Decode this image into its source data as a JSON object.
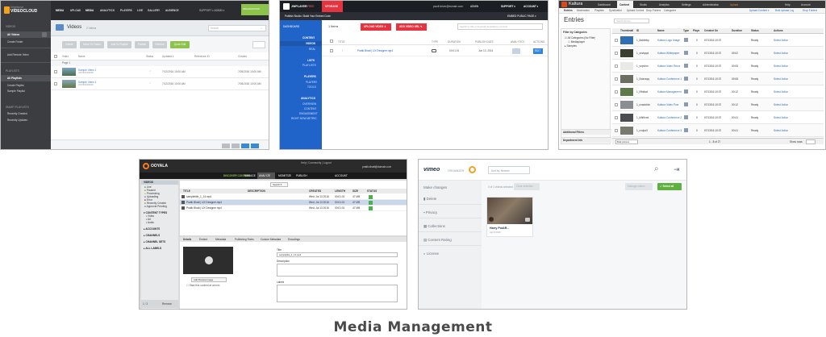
{
  "caption": "Media Management",
  "brightcove": {
    "brand_top": "brightcove",
    "brand": "VIDEOCLOUD",
    "nav": [
      "MEDIA",
      "UPLOAD",
      "MEDIA",
      "ANALYTICS",
      "PLAYERS",
      "LIVE",
      "GALLERY",
      "AUDIENCE"
    ],
    "user": "SUPPORT ▾  ADMIN ▾",
    "badge": "ORGANIZATION",
    "side_header": "VIDEOS",
    "side_items": [
      "All Videos",
      "Create Folder"
    ],
    "side_add": "Add Remote Video",
    "side_playlists_header": "PLAYLISTS",
    "side_playlists": [
      "All Playlists",
      "Create Playlist",
      "Sample Playlist"
    ],
    "side_smart_header": "SMART PLAYLISTS",
    "side_smart": [
      "Recently Created",
      "Recently Updated"
    ],
    "page_title": "Videos",
    "page_count": "2 Videos",
    "search_placeholder": "Search",
    "toolbar_buttons": [
      "Delete",
      "Move To Folder",
      "Add To Playlist",
      "Publish",
      "Refresh",
      "Quick Edit"
    ],
    "columns": [
      "Video",
      "Name",
      "Status",
      "Updated ▾",
      "Reference ID",
      "Created"
    ],
    "page_label": "Page 1",
    "rows": [
      {
        "name": "Sample Video 2",
        "sub": "2207902408400",
        "date": "7/12/2016 10:00 AM",
        "created": "7/05/2016 10:00 AM"
      },
      {
        "name": "Sample Video 1",
        "sub": "2207902408400",
        "date": "7/12/2016 10:00 AM",
        "created": "7/05/2016 10:00 AM"
      }
    ]
  },
  "jwplayer": {
    "brand": "JWPLAYER",
    "plan": "FREE",
    "upgrade": "UPGRADE",
    "crumb": "Publish Studio  /  Build Your Embed Code",
    "email": "pwolf.driver@domain.com",
    "top_right": [
      "ADMIN",
      "SUPPORT ▾",
      "ACCOUNT ▾"
    ],
    "sub_link": "EMBED PUBLIC PAGE ▾",
    "side_top": "DASHBOARD",
    "side_groups": [
      {
        "header": "CONTENT",
        "items": [
          "VIDEOS",
          "REAL"
        ]
      },
      {
        "header": "LISTS",
        "items": [
          "PLAYLISTS"
        ]
      },
      {
        "header": "PLAYERS",
        "items": [
          "PLAYERS",
          "TOOLS"
        ]
      },
      {
        "header": "ANALYTICS",
        "items": [
          "OVERVIEW",
          "CONTENT",
          "ENGAGEMENT",
          "RIGHT NOW METRIC"
        ]
      }
    ],
    "count": "1 Items",
    "search_placeholder": "Search by title or keyword (separate by comma)",
    "upload_button": "UPLOAD VIDEO ⬆",
    "add_button": "ADD VIDEO URL ✎",
    "columns": [
      "TITLE",
      "TYPE",
      "DURATION",
      "PUBLISH DATE",
      "ANALYTICS",
      "ACTIONS"
    ],
    "row": {
      "title": "Pratik Bhatt | UX Designer.mp4",
      "duration": "00:01:01",
      "date": "Jun 13, 2016",
      "action": "EDIT"
    }
  },
  "kaltura": {
    "brand": "Kaltura",
    "top_tabs": [
      "Dashboard",
      "Content",
      "Studio",
      "Analytics",
      "Settings",
      "Administration"
    ],
    "help_links": [
      "Upload",
      "Help",
      "Account"
    ],
    "sub_tabs": [
      "Entries",
      "Moderation",
      "Playlists",
      "Syndication",
      "Upload Control",
      "Drop Folders",
      "Categories"
    ],
    "sub_right": [
      "Upload Content ▾",
      "Bulk Upload Log",
      "Drop Folders"
    ],
    "title": "Entries",
    "search_placeholder": "Search Entries",
    "filter_header": "Filter by Categories",
    "filter_items": [
      "All Categories (No Filter)",
      "Mediaplayer",
      "Samples"
    ],
    "columns": [
      "Thumbnail",
      "ID",
      "Name",
      "Type",
      "Plays",
      "Created On",
      "Duration",
      "Status",
      "Actions"
    ],
    "rows": [
      {
        "id": "1_8abbbkp",
        "name": "Kaltura Logo Image",
        "plays": "0",
        "date": "07/13/16 10:37",
        "dur": "",
        "status": "Ready",
        "action": "Select Action",
        "thumb": "#2f6fb3"
      },
      {
        "id": "1_zxvlqopt",
        "name": "Kaltura Whitepaper",
        "plays": "0",
        "date": "07/13/16 10:37",
        "dur": "00:02",
        "status": "Ready",
        "action": "Select Action",
        "thumb": "#3a3f2f"
      },
      {
        "id": "1_vnpvkm",
        "name": "Kaltura Video Recor",
        "plays": "0",
        "date": "07/13/16 10:37",
        "dur": "00:05",
        "status": "Ready",
        "action": "Select Action",
        "thumb": "#e9e9e6"
      },
      {
        "id": "1_0slzvxqq",
        "name": "Kaltura Conference 1",
        "plays": "0",
        "date": "07/13/16 10:37",
        "dur": "00:08",
        "status": "Ready",
        "action": "Select Action",
        "thumb": "#6b6f62"
      },
      {
        "id": "1_l9fnlkwl",
        "name": "Kaltura Management",
        "plays": "0",
        "date": "07/13/16 10:37",
        "dur": "00:12",
        "status": "Ready",
        "action": "Select Action",
        "thumb": "#5f7a4a"
      },
      {
        "id": "1_uvadohkn",
        "name": "Kaltura Video Pow",
        "plays": "0",
        "date": "07/13/16 10:37",
        "dur": "00:12",
        "status": "Ready",
        "action": "Select Action",
        "thumb": "#8a8d91"
      },
      {
        "id": "1_kifk9xml",
        "name": "Kaltura Conference 2",
        "plays": "0",
        "date": "07/13/16 10:37",
        "dur": "00:41",
        "status": "Ready",
        "action": "Select Action",
        "thumb": "#4a4d52"
      },
      {
        "id": "1_uvdpx3",
        "name": "Kaltura Conference 3",
        "plays": "0",
        "date": "07/13/16 10:37",
        "dur": "00:41",
        "status": "Ready",
        "action": "Select Action",
        "thumb": "#777a6c"
      }
    ],
    "additional_filters": "Additional Filters",
    "department": "Department Info",
    "bulk": "Bulk Actions",
    "pagination": "1 - 8 of 27",
    "show_rows": "Show rows"
  },
  "ooyala": {
    "brand": "OOYALA",
    "top_tabs": [
      "MANAGE",
      "ANALYZE",
      "MONETIZE",
      "PUBLISH"
    ],
    "discover": "DISCOVER CONTENT",
    "account_tab": "ACCOUNT",
    "help": "Help | Community | Logout",
    "user": "pratik.bhatt@domain.com",
    "filters": [
      "Live",
      "Paused",
      "Processing",
      "Uploading",
      "Error",
      "Recently Created",
      "Approval Pending"
    ],
    "videos_header": "VIDEOS",
    "content_types_header": "CONTENT TYPES",
    "content_types": [
      "Video",
      "Ad",
      "Audio"
    ],
    "sections": [
      "ACCOUNTS",
      "CHANNELS",
      "CHANNEL SETS",
      "ALL LABELS"
    ],
    "search_button": "Search ▾",
    "columns": [
      "TITLE",
      "DESCRIPTION",
      "CREATED",
      "LENGTH",
      "SIZE",
      "STATUS"
    ],
    "rows": [
      {
        "title": "sampletitle_1_14.mp4",
        "created": "Wed, Jul 13 2016",
        "length": "00:01:01",
        "size": "47 MB"
      },
      {
        "title": "Pratik Bhatt | UX Designer.mp4",
        "created": "Wed, Jul 13 2016",
        "length": "00:01:01",
        "size": "47 MB"
      },
      {
        "title": "Pratik Bhatt | UX Designer.mp4",
        "created": "Wed, Jul 13 2016",
        "length": "00:01:01",
        "size": "47 MB"
      }
    ],
    "detail_tabs": [
      "Details",
      "Embed",
      "Metadata",
      "Publishing Rules",
      "Custom Metadata",
      "Encodings"
    ],
    "title_label": "Title",
    "title_value": "sampletitle_1_14.mp4",
    "description_label": "Description",
    "labels_label": "Labels",
    "preview_button": "Add Preview Image",
    "checkbox_text": "Start this content at ad mix",
    "bottom_left": "1 / 3",
    "bottom_button": "Remove"
  },
  "vimeo": {
    "brand": "vimeo",
    "brand_sub": "ORGANIZER",
    "sort": "Sort by: Newest",
    "side_header": "Make changes",
    "side_items": [
      "Delete",
      "Privacy",
      "Collections",
      "Content Rating",
      "License"
    ],
    "selection_text": "0 of 1 videos selected",
    "selection_button": "Clear selection",
    "manage_button": "Manage videos",
    "select_all": "✓ Select all",
    "video_title": "Harry PotAR...",
    "video_date": "Apr 8 2016"
  }
}
